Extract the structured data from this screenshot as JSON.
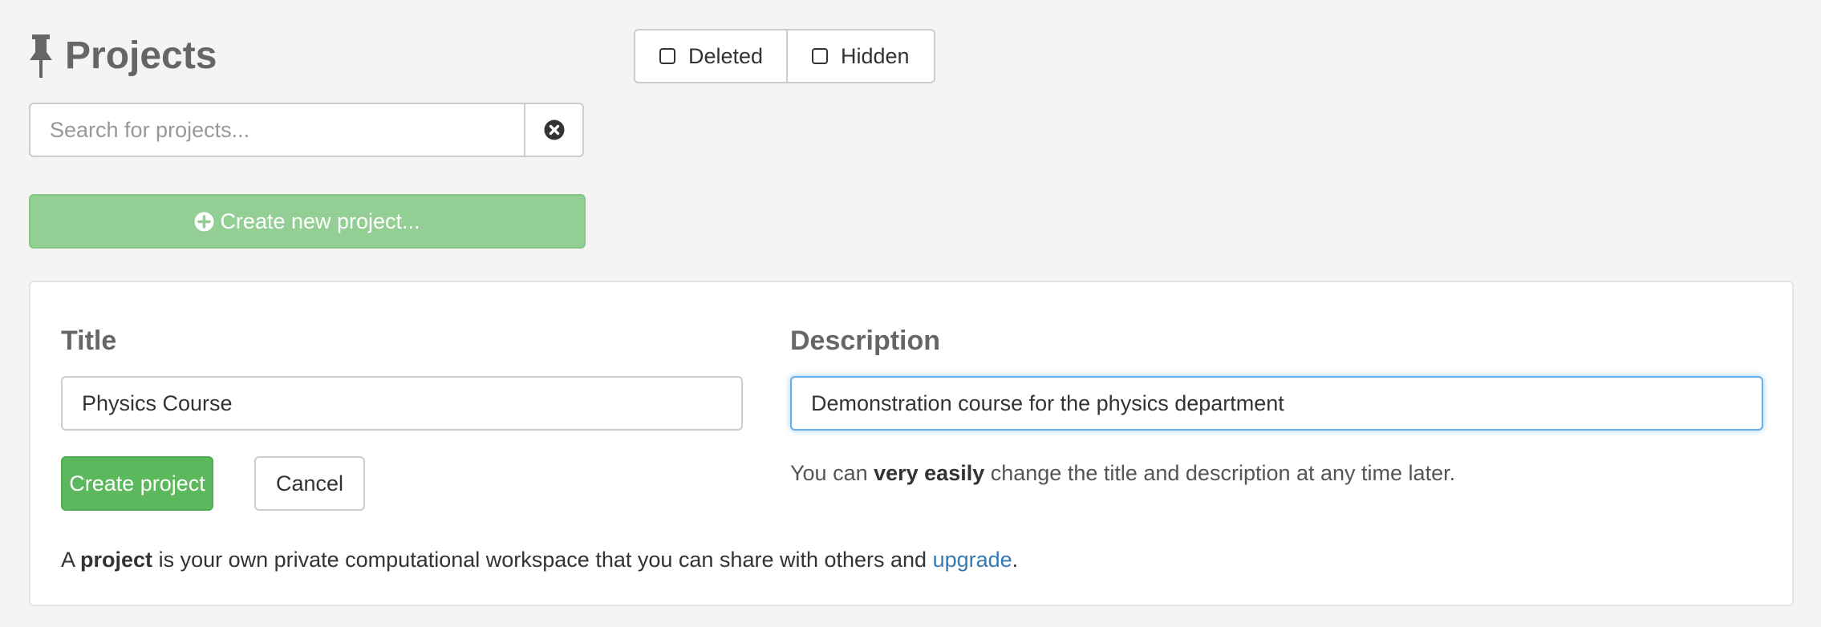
{
  "header": {
    "title": "Projects",
    "title_icon": "pin-icon"
  },
  "filters": {
    "deleted_label": "Deleted",
    "hidden_label": "Hidden",
    "deleted_checked": false,
    "hidden_checked": false
  },
  "search": {
    "placeholder": "Search for projects...",
    "value": "",
    "clear_icon": "times-circle-icon"
  },
  "create_new_button": {
    "label": "Create new project...",
    "icon": "plus-circle-icon"
  },
  "form": {
    "title_label": "Title",
    "title_value": "Physics Course",
    "description_label": "Description",
    "description_value": "Demonstration course for the physics department",
    "create_label": "Create project",
    "cancel_label": "Cancel",
    "hint": {
      "before": "You can ",
      "bold": "very easily",
      "after": " change the title and description at any time later."
    },
    "explain": {
      "before": "A ",
      "bold": "project",
      "middle": " is your own private computational workspace that you can share with others and ",
      "link": "upgrade",
      "after": "."
    }
  },
  "colors": {
    "background": "#f4f4f4",
    "create_new_bg": "#93cf94",
    "create_btn_bg": "#5cb85c",
    "link": "#337ab7",
    "focus_border": "#66afe9"
  }
}
